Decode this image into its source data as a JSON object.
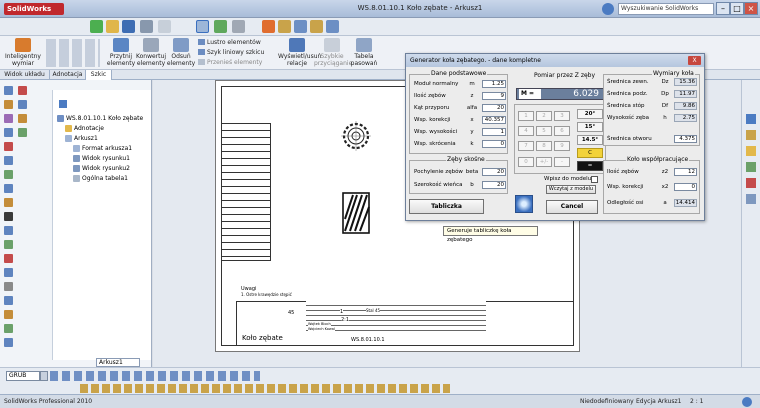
{
  "app": {
    "logo": "SolidWorks",
    "document_title": "WS.8.01.10.1 Koło zębate - Arkusz1",
    "search_placeholder": "Wyszukiwanie SolidWorks"
  },
  "ribbon": {
    "buttons": [
      {
        "label": "Inteligentny wymiar"
      },
      {
        "label": "Przytnij elementy"
      },
      {
        "label": "Konwertuj elementy"
      },
      {
        "label": "Odsuń elementy"
      },
      {
        "label": "Wyświetl/usuń relacje"
      },
      {
        "label": "Szybkie przyciąganie"
      },
      {
        "label": "Tabela pasowań"
      }
    ],
    "small_items": [
      "Lustro elementów",
      "Szyk liniowy szkicu",
      "Przenieś elementy"
    ]
  },
  "tabs": [
    "Widok układu",
    "Adnotacja",
    "Szkic"
  ],
  "tree": {
    "root": "WS.8.01.10.1 Koło zębate",
    "items": [
      "Adnotacje",
      "Arkusz1",
      "Format arkusza1",
      "Widok rysunku1",
      "Widok rysunku2",
      "Ogólna tabela1"
    ]
  },
  "sheet_tab": "Arkusz1",
  "drawing": {
    "notes_title": "Uwagi",
    "note_1": "1.   Ostre krawędzie stępić",
    "part_title": "Koło zębate",
    "part_number": "WS.8.01.10.1",
    "scale": "2:1",
    "sheet_number": "1",
    "size_45": "45",
    "material_label": "Stal 45",
    "roughness": "√",
    "title_block_owner": "Wojtek Bloch",
    "title_block_checked": "Wojciech Kowal"
  },
  "dialog": {
    "title": "Generator koła zębatego. - dane kompletne",
    "close_label": "X",
    "basic": {
      "title": "Dane podstawowe",
      "rows": [
        {
          "label": "Moduł normalny",
          "sym": "m",
          "value": "1.25"
        },
        {
          "label": "Ilość zębów",
          "sym": "z",
          "value": "9"
        },
        {
          "label": "Kąt przyporu",
          "sym": "alfa",
          "value": "20"
        },
        {
          "label": "Wsp. korekcji",
          "sym": "x",
          "value": "40.357"
        },
        {
          "label": "Wsp. wysokości",
          "sym": "y",
          "value": "1"
        },
        {
          "label": "Wsp. skrócenia",
          "sym": "k",
          "value": "0"
        }
      ]
    },
    "helical": {
      "title": "Zęby skośne",
      "rows": [
        {
          "label": "Pochylenie zębów",
          "sym": "beta",
          "value": "20"
        },
        {
          "label": "Szerokość wieńca",
          "sym": "b",
          "value": "20"
        }
      ]
    },
    "calc": {
      "title": "Pomiar przez Z zęby",
      "mem_label": "M =",
      "display": "6.029",
      "keys": [
        "1",
        "2",
        "3",
        "4",
        "5",
        "6",
        "7",
        "8",
        "9",
        "0",
        "+/-",
        "-"
      ],
      "side_keys": [
        "20°",
        "15°",
        "14.5°",
        "C",
        "="
      ]
    },
    "checkbox_label": "Wpisz do modelu",
    "insert_button": "Wczytaj z modelu",
    "table_button": "Tabliczka",
    "cancel_button": "Cancel",
    "gear_dims": {
      "title": "Wymiary koła",
      "rows": [
        {
          "label": "Średnica zewn.",
          "sym": "Dz",
          "value": "15.36"
        },
        {
          "label": "Średnica podz.",
          "sym": "Dp",
          "value": "11.97"
        },
        {
          "label": "Średnica stóp",
          "sym": "Df",
          "value": "9.86"
        },
        {
          "label": "Wysokość zęba",
          "sym": "h",
          "value": "2.75"
        }
      ],
      "bore_label": "Średnica otworu",
      "bore_value": "4.375"
    },
    "mating": {
      "title": "Koło współpracujące",
      "rows": [
        {
          "label": "Ilość zębów",
          "sym": "z2",
          "value": "12"
        },
        {
          "label": "Wsp. korekcji",
          "sym": "x2",
          "value": "0"
        },
        {
          "label": "Odległość osi",
          "sym": "a",
          "value": "14.414"
        }
      ]
    }
  },
  "tooltip": "Generuje tabliczkę koła zębatego",
  "bottom": {
    "layer_select": "GRUB"
  },
  "status": {
    "left": "SolidWorks Professional 2010",
    "undefined": "Niedodefiniowany",
    "edit": "Edycja Arkusz1",
    "scale": "2 : 1"
  },
  "colors": {
    "accent_blue": "#3a6fbf",
    "calc_display_bg": "#6b7f9c",
    "c_key": "#f2d23a"
  }
}
